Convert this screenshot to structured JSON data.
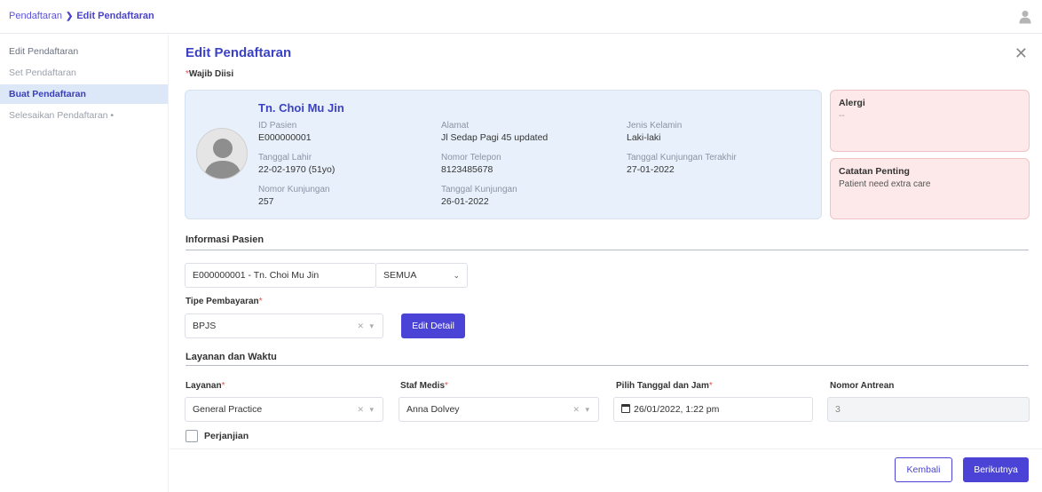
{
  "breadcrumb": {
    "root": "Pendaftaran",
    "current": "Edit Pendaftaran"
  },
  "sidebar": {
    "items": [
      {
        "label": "Edit Pendaftaran"
      },
      {
        "label": "Set Pendaftaran"
      },
      {
        "label": "Buat Pendaftaran"
      },
      {
        "label": "Selesaikan Pendaftaran •"
      }
    ]
  },
  "page": {
    "title": "Edit Pendaftaran",
    "required_note": "Wajib Diisi",
    "required_star": "*"
  },
  "patient": {
    "name": "Tn. Choi Mu Jin",
    "id_label": "ID Pasien",
    "id_value": "E000000001",
    "dob_label": "Tanggal Lahir",
    "dob_value": "22-02-1970 (51yo)",
    "visit_no_label": "Nomor Kunjungan",
    "visit_no_value": "257",
    "address_label": "Alamat",
    "address_value": "Jl Sedap Pagi 45 updated",
    "phone_label": "Nomor Telepon",
    "phone_value": "8123485678",
    "visit_date_label": "Tanggal Kunjungan",
    "visit_date_value": "26-01-2022",
    "gender_label": "Jenis Kelamin",
    "gender_value": "Laki-laki",
    "last_visit_label": "Tanggal Kunjungan Terakhir",
    "last_visit_value": "27-01-2022"
  },
  "allergy": {
    "title": "Alergi",
    "text": "--"
  },
  "notes": {
    "title": "Catatan Penting",
    "text": "Patient need extra care"
  },
  "patient_info": {
    "section": "Informasi Pasien",
    "patient_select": "E000000001 - Tn. Choi Mu Jin",
    "filter_select": "SEMUA",
    "payment_label": "Tipe Pembayaran",
    "payment_value": "BPJS",
    "edit_detail": "Edit Detail"
  },
  "service": {
    "section": "Layanan dan Waktu",
    "service_label": "Layanan",
    "service_value": "General Practice",
    "staff_label": "Staf Medis",
    "staff_value": "Anna Dolvey",
    "datetime_label": "Pilih Tanggal dan Jam",
    "datetime_value": "26/01/2022, 1:22 pm",
    "queue_label": "Nomor Antrean",
    "queue_value": "3",
    "appointment_label": "Perjanjian"
  },
  "footer": {
    "back": "Kembali",
    "next": "Berikutnya"
  },
  "colors": {
    "accent": "#4a43d6",
    "card_bg": "#e8f1fb",
    "alert_bg": "#fde9e9"
  }
}
